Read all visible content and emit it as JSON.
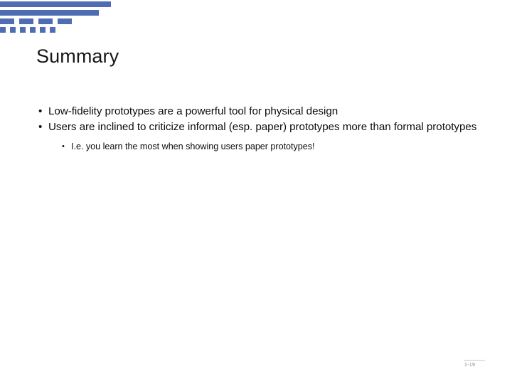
{
  "slide": {
    "title": "Summary",
    "accent_color": "#4f6db5",
    "background_color": "#ffffff",
    "text_color": "#0d0d0f"
  },
  "decoration": {
    "name": "stepped-dashed-bars",
    "color": "#4f6db5",
    "rows": [
      {
        "segments": [
          {
            "w": 156,
            "gap": 0
          }
        ],
        "h": 8
      },
      {
        "segments": [
          {
            "w": 139,
            "gap": 0
          }
        ],
        "h": 8
      },
      {
        "segments": [
          {
            "w": 20,
            "gap": 7
          },
          {
            "w": 20,
            "gap": 7
          },
          {
            "w": 20,
            "gap": 7
          },
          {
            "w": 20,
            "gap": 0
          }
        ],
        "h": 8
      },
      {
        "segments": [
          {
            "w": 8,
            "gap": 6
          },
          {
            "w": 8,
            "gap": 6
          },
          {
            "w": 8,
            "gap": 6
          },
          {
            "w": 8,
            "gap": 6
          },
          {
            "w": 8,
            "gap": 6
          },
          {
            "w": 8,
            "gap": 0
          }
        ],
        "h": 8
      }
    ]
  },
  "body": {
    "bullet_marker": "•",
    "sub_bullet_marker": "•",
    "bullets": [
      {
        "level": 1,
        "text": "Low-fidelity prototypes are a powerful tool for physical design"
      },
      {
        "level": 1,
        "text": "Users are inclined to criticize informal (esp. paper) prototypes more than formal prototypes"
      }
    ],
    "sub_bullets": [
      {
        "level": 2,
        "text": "I.e. you learn the most when showing users paper prototypes!"
      }
    ]
  },
  "footer": {
    "page_number": "1-19"
  }
}
